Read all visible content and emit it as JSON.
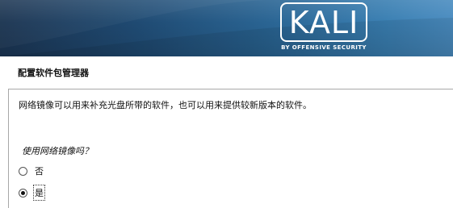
{
  "banner": {
    "logo_word": "KALI",
    "logo_tagline": "BY OFFENSIVE SECURITY"
  },
  "page": {
    "title": "配置软件包管理器"
  },
  "main": {
    "description": "网络镜像可以用来补充光盘所带的软件，也可以用来提供较新版本的软件。",
    "question": "使用网络镜像吗？",
    "options": [
      {
        "label": "否",
        "selected": false
      },
      {
        "label": "是",
        "selected": true
      }
    ]
  }
}
